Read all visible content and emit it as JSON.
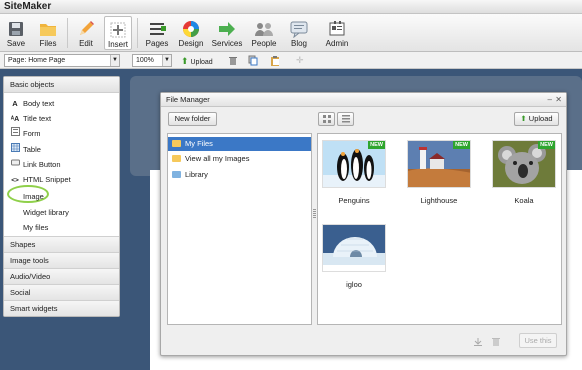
{
  "app": {
    "title": "SiteMaker"
  },
  "toolbar": {
    "items": [
      {
        "label": "Save",
        "icon": "save-icon"
      },
      {
        "label": "Files",
        "icon": "folder-icon"
      },
      {
        "label": "Edit",
        "icon": "pencil-icon"
      },
      {
        "label": "Insert",
        "icon": "insert-plus-icon"
      },
      {
        "label": "Pages",
        "icon": "pages-list-icon"
      },
      {
        "label": "Design",
        "icon": "color-wheel-icon"
      },
      {
        "label": "Services",
        "icon": "services-arrow-icon"
      },
      {
        "label": "People",
        "icon": "people-icon"
      },
      {
        "label": "Blog",
        "icon": "blog-icon"
      },
      {
        "label": "Admin",
        "icon": "admin-icon"
      }
    ],
    "active": "Insert"
  },
  "subbar": {
    "page_select": "Page: Home Page",
    "zoom_select": "100%",
    "upload_label": "Upload"
  },
  "left_panel": {
    "header": "Basic objects",
    "items": [
      {
        "label": "Body text",
        "glyph": "A"
      },
      {
        "label": "Title text",
        "glyph": "A"
      },
      {
        "label": "Form",
        "glyph": ""
      },
      {
        "label": "Table",
        "glyph": ""
      },
      {
        "label": "Link Button",
        "glyph": ""
      },
      {
        "label": "HTML Snippet",
        "glyph": "<>"
      }
    ],
    "sub_items": [
      "Image",
      "Widget library",
      "My files"
    ],
    "sections": [
      "Shapes",
      "Image tools",
      "Audio/Video",
      "Social",
      "Smart widgets"
    ]
  },
  "file_manager": {
    "title": "File Manager",
    "new_folder_label": "New folder",
    "upload_label": "Upload",
    "use_this_label": "Use this",
    "folders": [
      "My Files",
      "View all my Images",
      "Library"
    ],
    "selected_folder": "My Files",
    "files": [
      {
        "name": "Penguins",
        "badge": "NEW"
      },
      {
        "name": "Lighthouse",
        "badge": "NEW"
      },
      {
        "name": "Koala",
        "badge": "NEW"
      },
      {
        "name": "igloo",
        "badge": ""
      }
    ]
  },
  "colors": {
    "selection": "#3b78c6",
    "badge": "#2ea52e",
    "highlight": "#8fd04a",
    "desktop": "#3b5678"
  }
}
